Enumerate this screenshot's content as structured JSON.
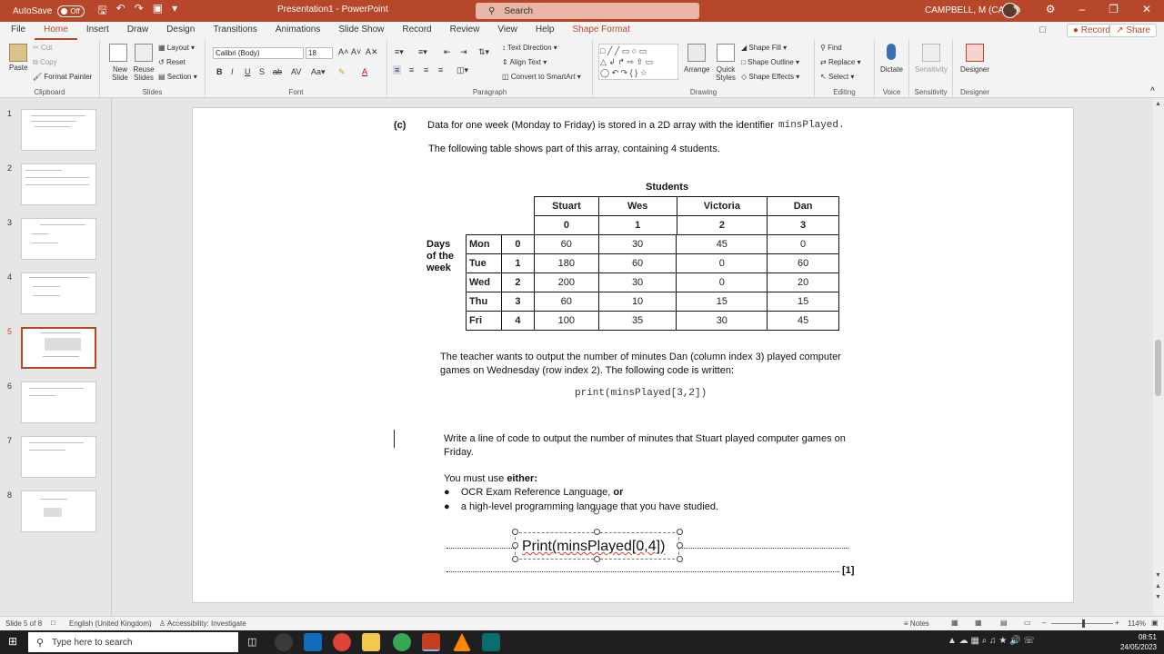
{
  "window": {
    "autosave": "AutoSave",
    "autosave_state": "Off",
    "doc_title": "Presentation1 - PowerPoint",
    "search_label": "Search",
    "user_name": "CAMPBELL, M (CAM2)",
    "accent": "#b7472a"
  },
  "tabs": [
    "File",
    "Home",
    "Insert",
    "Draw",
    "Design",
    "Transitions",
    "Animations",
    "Slide Show",
    "Record",
    "Review",
    "View",
    "Help",
    "Shape Format"
  ],
  "ribbon_actions": {
    "record": "Record",
    "share": "Share"
  },
  "ribbon": {
    "clipboard": {
      "label": "Clipboard",
      "paste": "Paste",
      "cut": "Cut",
      "copy": "Copy",
      "format_painter": "Format Painter"
    },
    "slides": {
      "label": "Slides",
      "new_slide": "New Slide",
      "reuse_slides": "Reuse Slides",
      "layout": "Layout",
      "reset": "Reset",
      "section": "Section"
    },
    "font": {
      "label": "Font",
      "family": "Calibri (Body)",
      "size": "18"
    },
    "paragraph": {
      "label": "Paragraph",
      "text_direction": "Text Direction",
      "align_text": "Align Text",
      "convert_smartart": "Convert to SmartArt"
    },
    "drawing": {
      "label": "Drawing",
      "arrange": "Arrange",
      "quick_styles": "Quick Styles",
      "shape_fill": "Shape Fill",
      "shape_outline": "Shape Outline",
      "shape_effects": "Shape Effects"
    },
    "editing": {
      "label": "Editing",
      "find": "Find",
      "replace": "Replace",
      "select": "Select"
    },
    "voice": {
      "label": "Voice",
      "dictate": "Dictate"
    },
    "sensitivity": {
      "label": "Sensitivity",
      "sensitivity": "Sensitivity"
    },
    "designer": {
      "label": "Designer",
      "designer": "Designer"
    }
  },
  "thumbnails": [
    "1",
    "2",
    "3",
    "4",
    "5",
    "6",
    "7",
    "8"
  ],
  "selected_slide": "5",
  "slide": {
    "part": "(c)",
    "intro_1": "Data for one week (Monday to Friday) is stored in a 2D array with the identifier",
    "identifier": "minsPlayed.",
    "intro_2": "The following table shows part of this array, containing 4 students.",
    "students_header": "Students",
    "days_label": [
      "Days",
      "of the",
      "week"
    ],
    "student_names": [
      "Stuart",
      "Wes",
      "Victoria",
      "Dan"
    ],
    "student_index": [
      "0",
      "1",
      "2",
      "3"
    ],
    "rows": [
      {
        "day": "Mon",
        "idx": "0",
        "vals": [
          "60",
          "30",
          "45",
          "0"
        ]
      },
      {
        "day": "Tue",
        "idx": "1",
        "vals": [
          "180",
          "60",
          "0",
          "60"
        ]
      },
      {
        "day": "Wed",
        "idx": "2",
        "vals": [
          "200",
          "30",
          "0",
          "20"
        ]
      },
      {
        "day": "Thu",
        "idx": "3",
        "vals": [
          "60",
          "10",
          "15",
          "15"
        ]
      },
      {
        "day": "Fri",
        "idx": "4",
        "vals": [
          "100",
          "35",
          "30",
          "45"
        ]
      }
    ],
    "teacher_1": "The teacher wants to output the number of minutes Dan (column index 3) played computer",
    "teacher_2": "games on Wednesday (row index 2). The following code is written:",
    "code": "print(minsPlayed[3,2])",
    "question_1": "Write a line of code to output the number of minutes that Stuart played computer games on",
    "question_2": "Friday.",
    "must_use_prefix": "You must use ",
    "must_use_bold": "either:",
    "bullet_1": "OCR Exam Reference Language, ",
    "bullet_1_bold": "or",
    "bullet_2": "a high-level programming language that you have studied.",
    "answer_text": "Print(minsPlayed[0,4])",
    "marks": "[1]"
  },
  "status": {
    "slide_of": "Slide 5 of 8",
    "language": "English (United Kingdom)",
    "accessibility": "Accessibility: Investigate",
    "notes": "Notes",
    "zoom": "114%"
  },
  "taskbar": {
    "search_placeholder": "Type here to search",
    "time": "08:51",
    "date": "24/05/2023"
  }
}
